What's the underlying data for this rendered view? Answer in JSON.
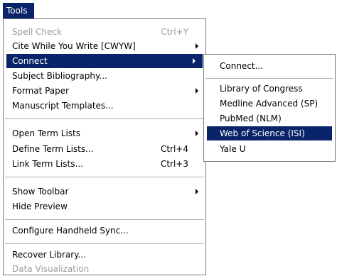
{
  "menubar": {
    "tools_label": "Tools"
  },
  "tools_menu": {
    "items": [
      {
        "label": "Spell Check",
        "shortcut": "Ctrl+Y",
        "disabled": true
      },
      {
        "label": "Cite While You Write [CWYW]",
        "submenu": true
      },
      {
        "label": "Connect",
        "submenu": true,
        "highlighted": true
      },
      {
        "label": "Subject Bibliography..."
      },
      {
        "label": "Format Paper",
        "submenu": true
      },
      {
        "label": "Manuscript Templates..."
      },
      {
        "label": "Open Term Lists",
        "submenu": true
      },
      {
        "label": "Define Term Lists...",
        "shortcut": "Ctrl+4"
      },
      {
        "label": "Link Term Lists...",
        "shortcut": "Ctrl+3"
      },
      {
        "label": "Show Toolbar",
        "submenu": true
      },
      {
        "label": "Hide Preview"
      },
      {
        "label": "Configure Handheld Sync..."
      },
      {
        "label": "Recover Library..."
      },
      {
        "label": "Data Visualization",
        "disabled": true
      }
    ]
  },
  "connect_submenu": {
    "items": [
      {
        "label": "Connect..."
      },
      {
        "label": "Library of Congress"
      },
      {
        "label": "Medline Advanced (SP)"
      },
      {
        "label": "PubMed (NLM)"
      },
      {
        "label": "Web of Science (ISI)",
        "highlighted": true
      },
      {
        "label": "Yale U"
      }
    ]
  },
  "colors": {
    "highlight": "#0a246a",
    "disabled_text": "#9a9a9a",
    "border": "#7a7a7a"
  }
}
